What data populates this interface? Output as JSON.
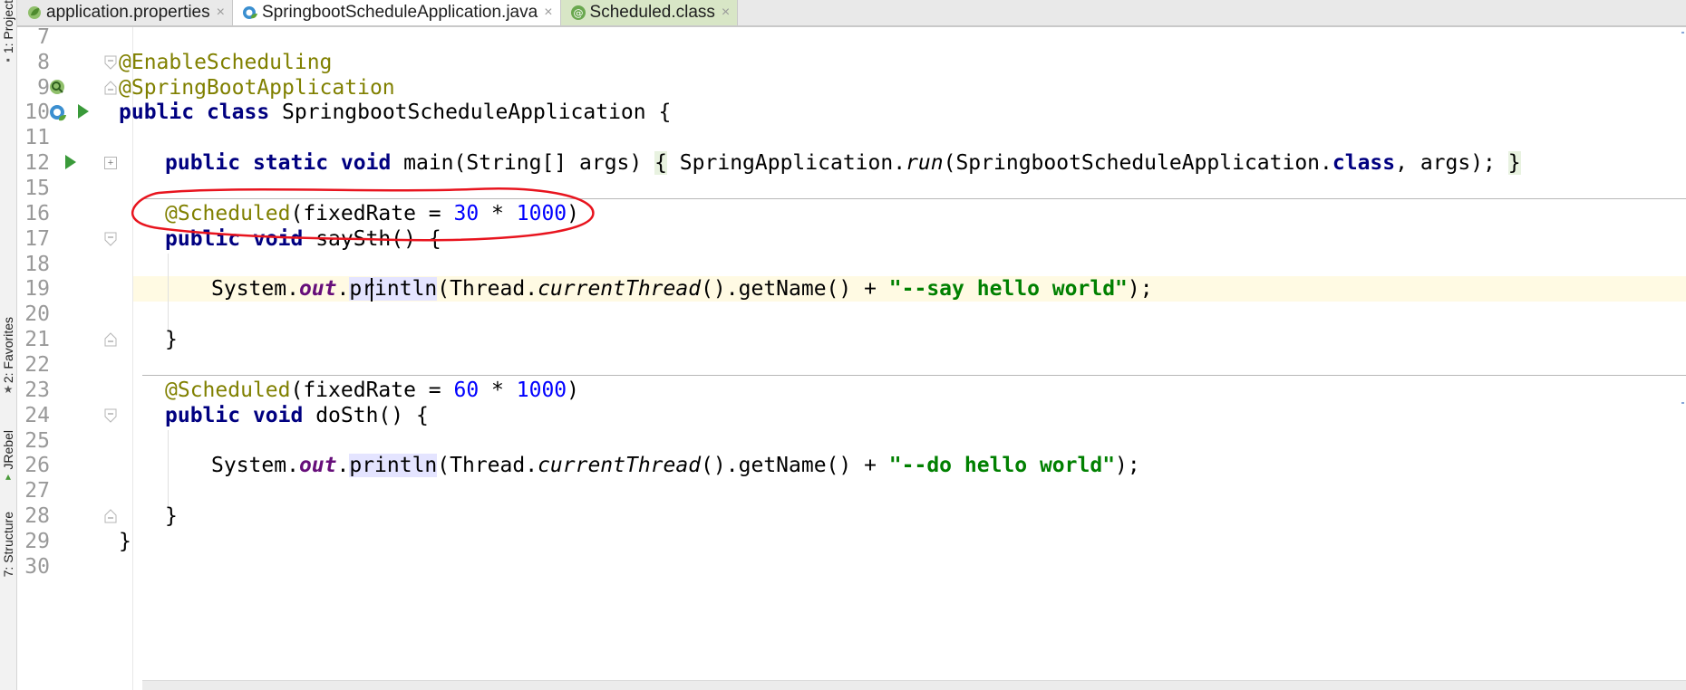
{
  "sidebar": {
    "project_label": "1: Project",
    "favorites_label": "2: Favorites",
    "jrebel_label": "JRebel",
    "structure_label": "7: Structure"
  },
  "tabs": [
    {
      "label": "application.properties",
      "close": "×"
    },
    {
      "label": "SpringbootScheduleApplication.java",
      "close": "×"
    },
    {
      "label": "Scheduled.class",
      "close": "×"
    }
  ],
  "lines": [
    {
      "num": "7"
    },
    {
      "num": "8",
      "a": "@EnableScheduling"
    },
    {
      "num": "9",
      "a": "@SpringBootApplication"
    },
    {
      "num": "10",
      "k1": "public",
      "s1": " ",
      "k2": "class",
      "t1": " SpringbootScheduleApplication {"
    },
    {
      "num": "11"
    },
    {
      "num": "12",
      "indent": "    ",
      "k1": "public",
      "k2": "static",
      "k3": "void",
      "t1": " main(String[] args) ",
      "b1": "{",
      "t2": " SpringApplication.",
      "i1": "run",
      "t3": "(SpringbootScheduleApplication.",
      "k4": "class",
      "t4": ", args); ",
      "b2": "}"
    },
    {
      "num": "15"
    },
    {
      "num": "16",
      "indent": "    ",
      "a": "@Scheduled",
      "t1": "(fixedRate = ",
      "n1": "30",
      "t2": " * ",
      "n2": "1000",
      "t3": ")"
    },
    {
      "num": "17",
      "indent": "    ",
      "k1": "public",
      "k2": "void",
      "t1": " saySth() {"
    },
    {
      "num": "18"
    },
    {
      "num": "19",
      "indent": "        ",
      "t1": "System.",
      "st": "out",
      "t2": ".",
      "m1": "pri",
      "m2": "ntln",
      "t3": "(Thread.",
      "i1": "currentThread",
      "t4": "().getName() + ",
      "str": "\"--say hello world\"",
      "t5": ");"
    },
    {
      "num": "20"
    },
    {
      "num": "21",
      "indent": "    ",
      "t1": "}"
    },
    {
      "num": "22"
    },
    {
      "num": "23",
      "indent": "    ",
      "a": "@Scheduled",
      "t1": "(fixedRate = ",
      "n1": "60",
      "t2": " * ",
      "n2": "1000",
      "t3": ")"
    },
    {
      "num": "24",
      "indent": "    ",
      "k1": "public",
      "k2": "void",
      "t1": " doSth() {"
    },
    {
      "num": "25"
    },
    {
      "num": "26",
      "indent": "        ",
      "t1": "System.",
      "st": "out",
      "t2": ".",
      "m1": "println",
      "t3": "(Thread.",
      "i1": "currentThread",
      "t4": "().getName() + ",
      "str": "\"--do hello world\"",
      "t5": ");"
    },
    {
      "num": "27"
    },
    {
      "num": "28",
      "indent": "    ",
      "t1": "}"
    },
    {
      "num": "29",
      "t1": "}"
    },
    {
      "num": "30"
    }
  ],
  "colors": {
    "annotation": "#808000",
    "keyword": "#000080",
    "number": "#0000ff",
    "string": "#008000",
    "static_field": "#660e7a",
    "current_line": "#fffae3",
    "red_circle": "#e8141e"
  },
  "icons": {
    "line9": "spring-bean-icon",
    "line10": "spring-run-icon",
    "line12": "run-icon"
  }
}
